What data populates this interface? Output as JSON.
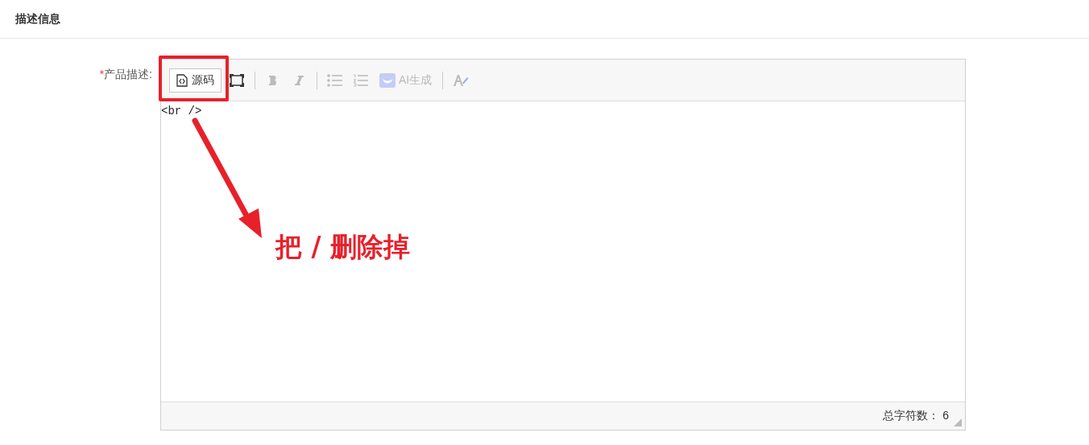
{
  "section": {
    "title": "描述信息"
  },
  "field": {
    "label": "产品描述",
    "required_mark": "*",
    "colon": ":"
  },
  "toolbar": [
    {
      "kind": "source",
      "label": "源码",
      "disabled": false
    },
    {
      "kind": "fullscreen",
      "disabled": false
    },
    {
      "kind": "divider"
    },
    {
      "kind": "bold",
      "disabled": true
    },
    {
      "kind": "italic",
      "disabled": true
    },
    {
      "kind": "divider"
    },
    {
      "kind": "bullets",
      "disabled": true
    },
    {
      "kind": "numbers",
      "disabled": true
    },
    {
      "kind": "ai",
      "label": "AI生成",
      "disabled": true
    },
    {
      "kind": "divider"
    },
    {
      "kind": "painter",
      "disabled": true
    }
  ],
  "editor": {
    "content": "<br />"
  },
  "footer": {
    "count_label": "总字符数：",
    "count": "6"
  },
  "annotation": {
    "text": "把 / 删除掉"
  }
}
